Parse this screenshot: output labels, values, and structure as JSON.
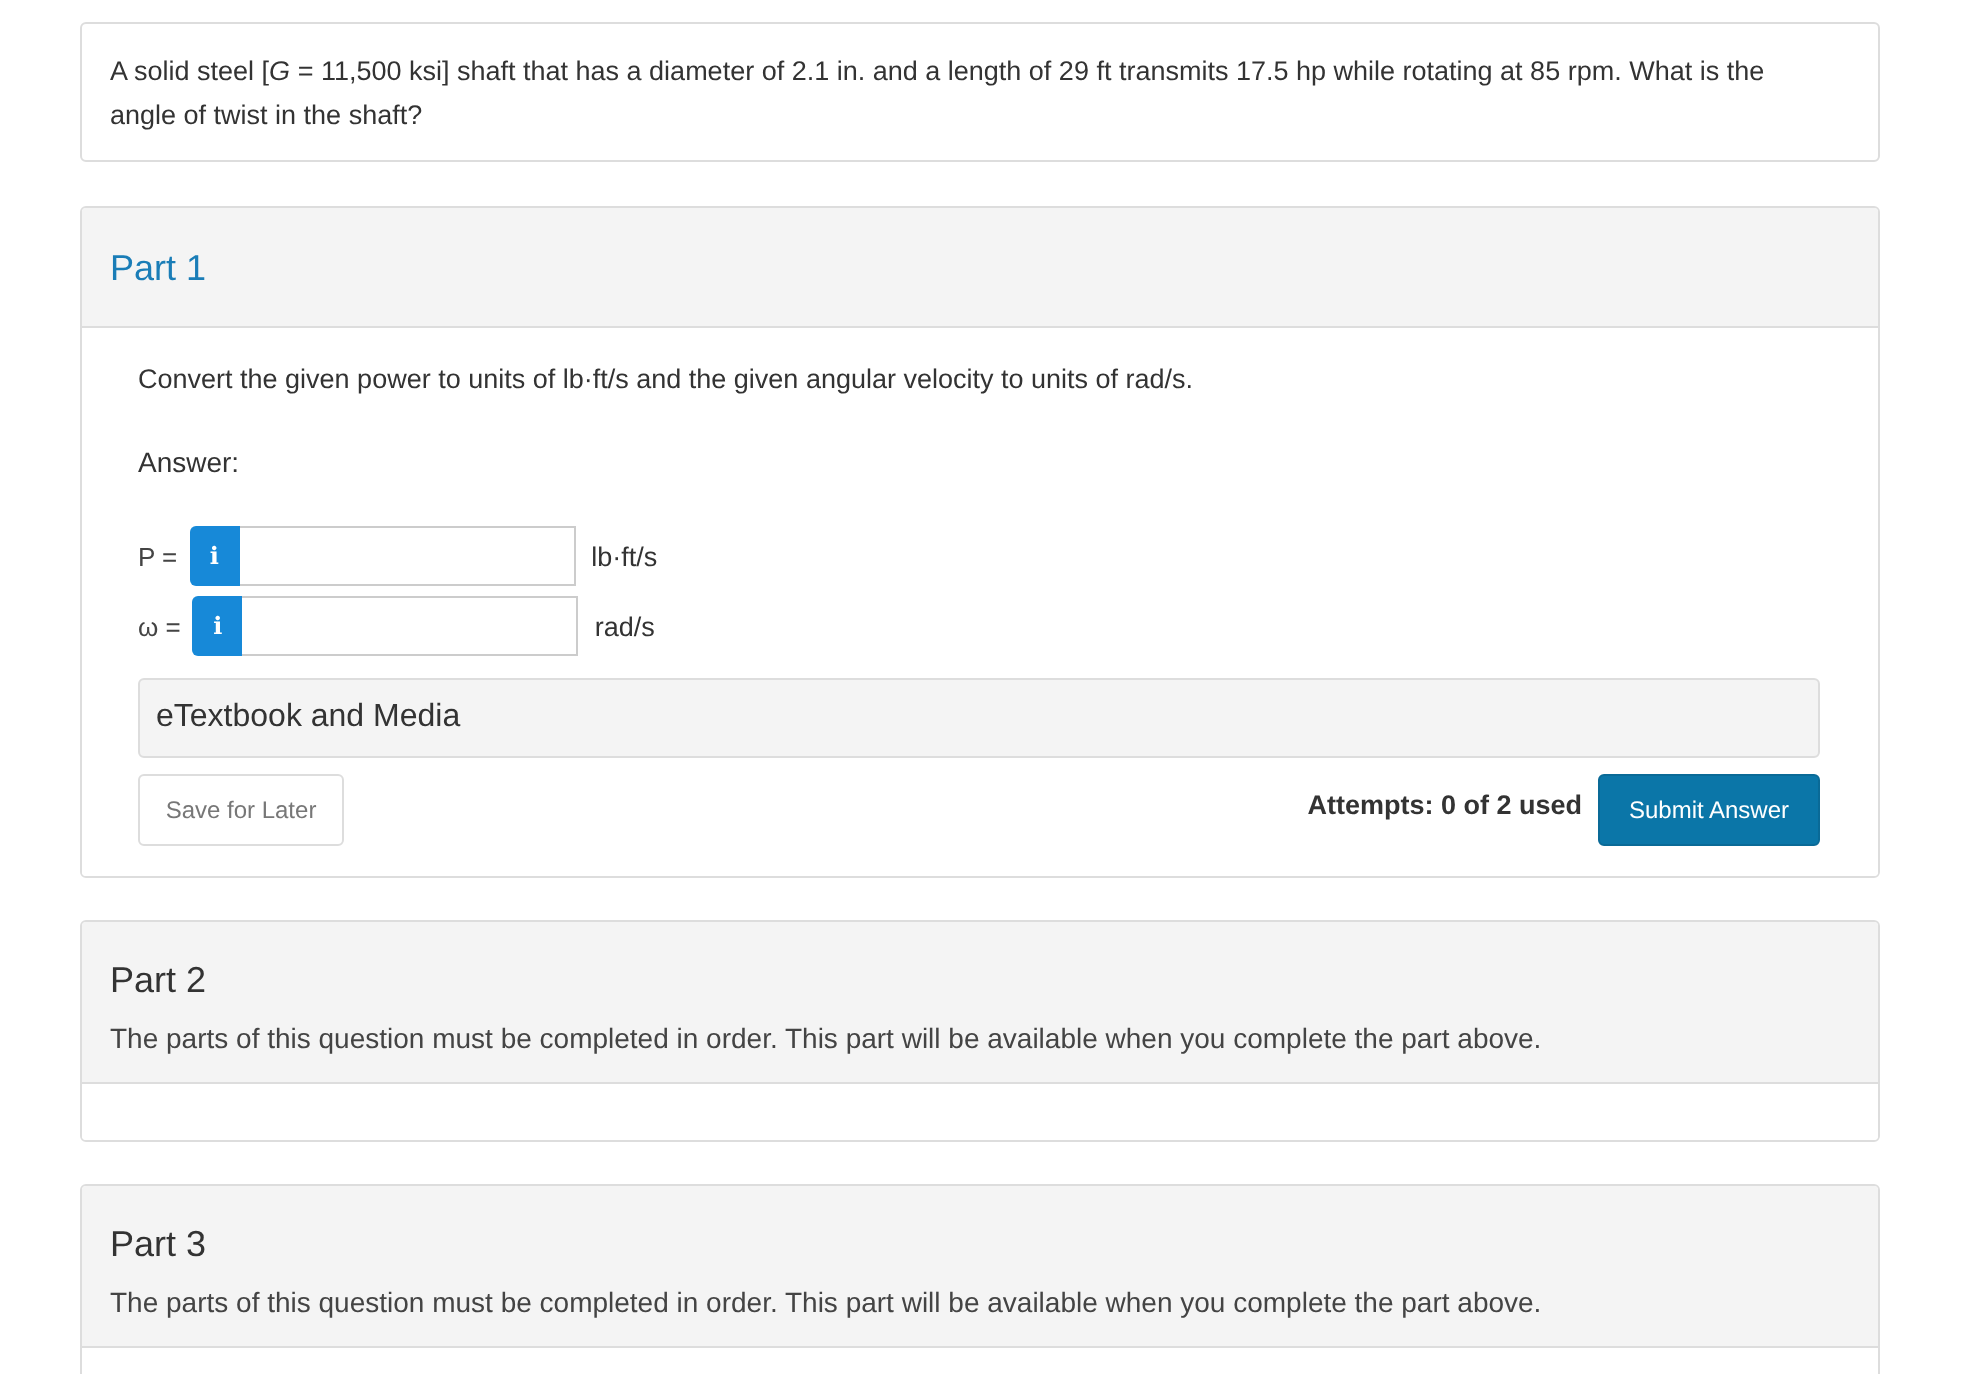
{
  "question": {
    "text": "A solid steel [*G* = 11,500 ksi] shaft that has a diameter of 2.1 in. and a length of 29 ft transmits 17.5 hp while rotating at 85 rpm. What is the angle of twist in the shaft?"
  },
  "parts": [
    {
      "title": "Part 1",
      "expanded": true,
      "instruction": "Convert the given power to units of lb·ft/s and the given angular velocity to units of rad/s.",
      "answer_label": "Answer:",
      "fields": [
        {
          "label": "P =",
          "info": "i",
          "unit": "lb·ft/s"
        },
        {
          "label": "ω =",
          "info": "i",
          "unit": "rad/s"
        }
      ],
      "resources": "eTextbook and Media",
      "save_button": "Save for Later",
      "attempts": "Attempts: 0 of 2 used",
      "submit_button": "Submit Answer"
    },
    {
      "title": "Part 2",
      "expanded": false,
      "notice": "The parts of this question must be completed in order. This part will be available when you complete the part above."
    },
    {
      "title": "Part 3",
      "expanded": false,
      "notice": "The parts of this question must be completed in order. This part will be available when you complete the part above."
    }
  ]
}
